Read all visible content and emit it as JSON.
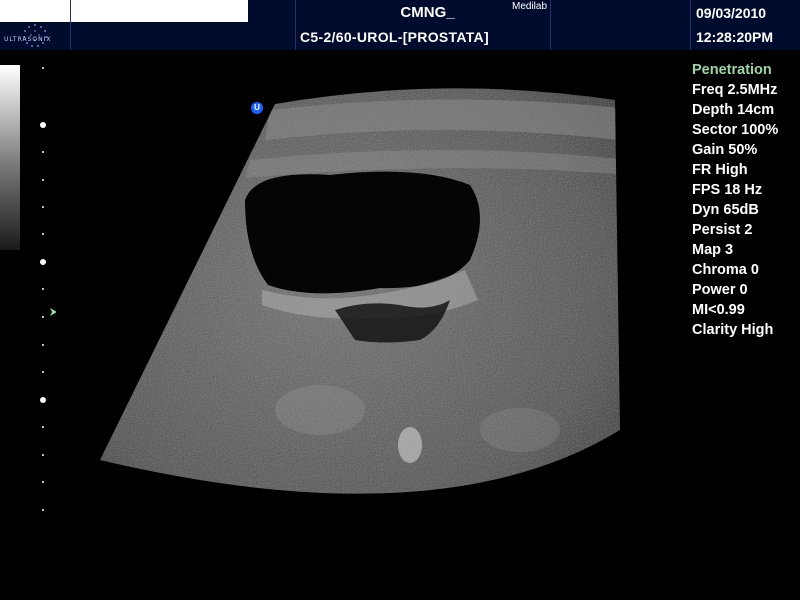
{
  "header": {
    "logo_text": "ULTRASONIX",
    "clinic": "CMNG_",
    "company": "Medilab",
    "preset": "C5-2/60-UROL-[PROSTATA]",
    "date": "09/03/2010",
    "time": "12:28:20PM"
  },
  "probe_marker": {
    "label": "U"
  },
  "parameters": [
    "Penetration",
    "Freq 2.5MHz",
    "Depth 14cm",
    "Sector 100%",
    "Gain 50%",
    "FR High",
    "FPS 18 Hz",
    "Dyn 65dB",
    "Persist 2",
    "Map 3",
    "Chroma 0",
    "Power 0",
    "MI<0.99",
    "Clarity High"
  ],
  "colors": {
    "header_bg": "#000b2e",
    "mode_text": "#9ad6a6",
    "probe_marker": "#1a5fff",
    "focus_marker": "#8fe0a0"
  }
}
